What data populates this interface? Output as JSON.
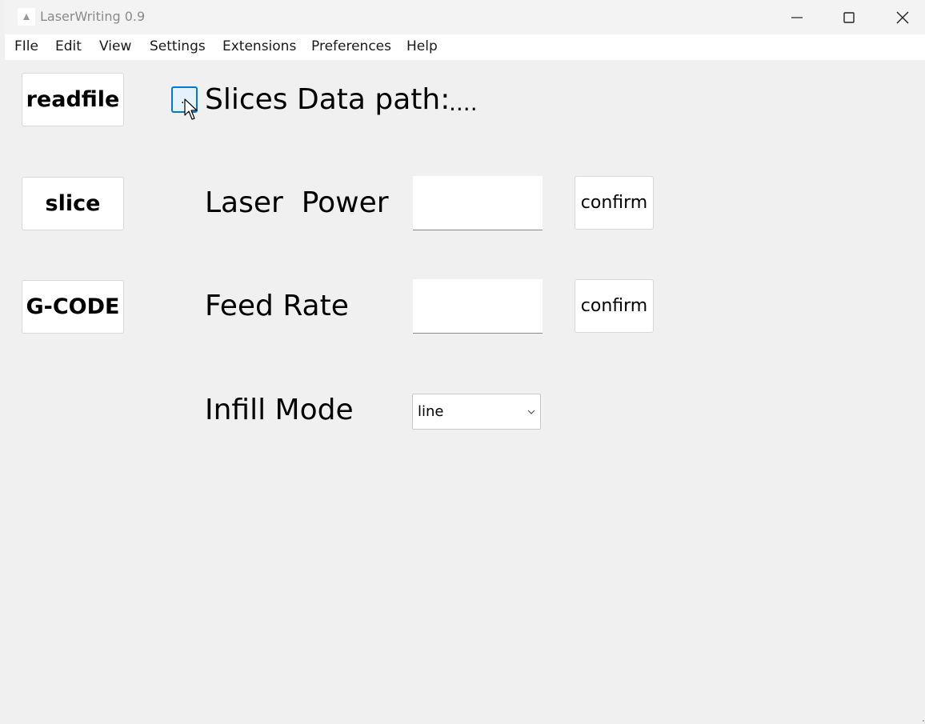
{
  "window": {
    "title": "LaserWriting 0.9",
    "icons": {
      "app": "app-icon",
      "minimize": "minimize-icon",
      "maximize": "maximize-icon",
      "close": "close-icon"
    }
  },
  "menu": {
    "items": [
      "FIle",
      "Edit",
      "View",
      "Settings",
      "Extensions",
      "Preferences",
      "Help"
    ]
  },
  "buttons": {
    "readfile": "readfile",
    "slice": "slice",
    "gcode": "G-CODE",
    "browse": "..",
    "confirm_power": "confirm",
    "confirm_feed": "confirm"
  },
  "labels": {
    "slices_path": "Slices Data path:",
    "slices_path_value": "....",
    "laser_power": "Laser  Power",
    "feed_rate": "Feed Rate",
    "infill_mode": "Infill Mode"
  },
  "inputs": {
    "laser_power_value": "",
    "feed_rate_value": ""
  },
  "infill_select": {
    "selected": "line",
    "icon": "chevron-down-icon"
  },
  "colors": {
    "accent": "#0078d4",
    "background": "#f0f0f0"
  }
}
